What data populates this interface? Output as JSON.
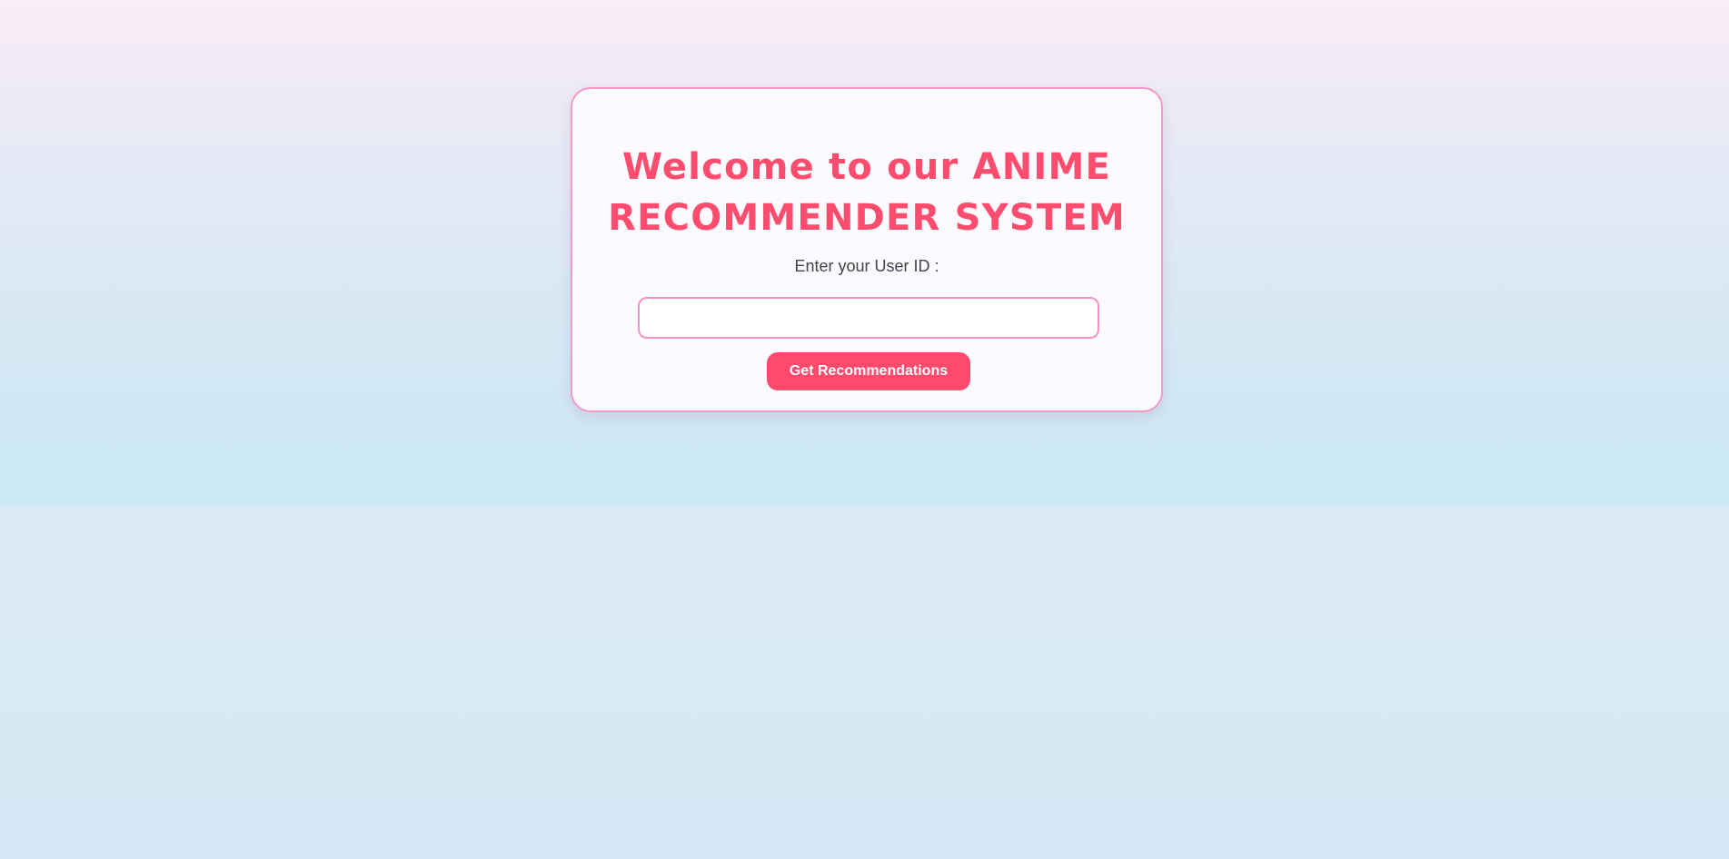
{
  "form": {
    "title": "Welcome to our ANIME RECOMMENDER SYSTEM",
    "user_id_label": "Enter your User ID :",
    "user_id_value": "",
    "submit_label": "Get Recommendations"
  },
  "colors": {
    "accent": "#fe4a6c",
    "title": "#fd4d6f",
    "border": "#f49ac8"
  }
}
